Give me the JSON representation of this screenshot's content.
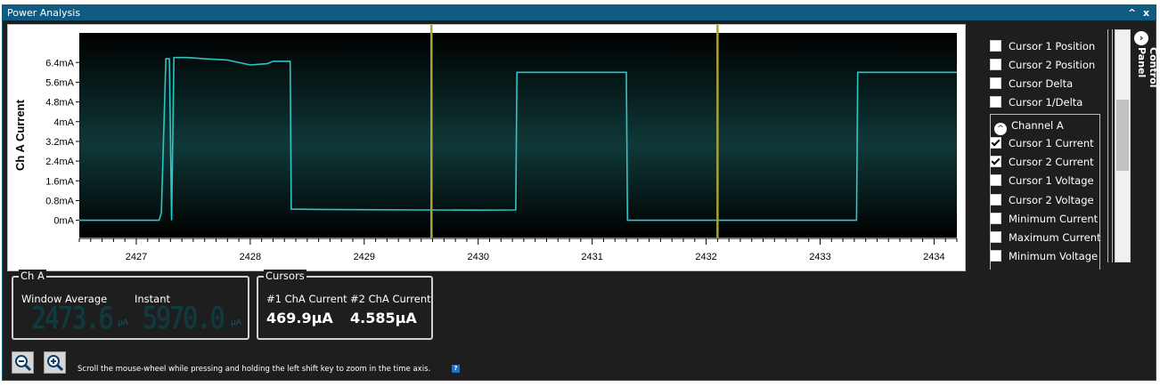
{
  "window": {
    "title": "Power Analysis",
    "controls": [
      "^",
      "x"
    ]
  },
  "chart_data": {
    "type": "line",
    "ylabel": "Ch A Current",
    "y_ticks": [
      "0mA",
      "0.8mA",
      "1.6mA",
      "2.4mA",
      "3.2mA",
      "4mA",
      "4.8mA",
      "5.6mA",
      "6.4mA"
    ],
    "x_ticks": [
      "2427",
      "2428",
      "2429",
      "2430",
      "2431",
      "2432",
      "2433",
      "2434"
    ],
    "xlim": [
      2426.5,
      2434.2
    ],
    "ylim": [
      -0.7,
      7.6
    ],
    "series": [
      {
        "color": "#2cc5c8",
        "x": [
          2426.5,
          2427.2,
          2427.22,
          2427.26,
          2427.29,
          2427.31,
          2427.33,
          2427.35,
          2427.45,
          2427.6,
          2427.8,
          2428.0,
          2428.15,
          2428.2,
          2428.25,
          2428.35,
          2428.36,
          2428.6,
          2429.0,
          2429.5,
          2430.0,
          2430.33,
          2430.34,
          2431.3,
          2431.31,
          2432.0,
          2433.32,
          2433.33,
          2434.2
        ],
        "y": [
          0,
          0,
          0.3,
          6.55,
          6.55,
          0,
          6.6,
          6.6,
          6.6,
          6.55,
          6.5,
          6.3,
          6.35,
          6.45,
          6.45,
          6.45,
          0.45,
          0.44,
          0.43,
          0.42,
          0.41,
          0.42,
          6.0,
          6.0,
          0,
          0,
          0,
          6.0,
          6.0
        ]
      }
    ],
    "cursors_x": [
      2429.59,
      2432.1
    ],
    "cursor_color": "#a9a13a",
    "grid": false
  },
  "control_panel": {
    "label": "Control Panel",
    "items_top": [
      {
        "label": "Cursor 1 Position",
        "checked": false
      },
      {
        "label": "Cursor 2 Position",
        "checked": false
      },
      {
        "label": "Cursor Delta",
        "checked": false
      },
      {
        "label": "Cursor 1/Delta",
        "checked": false
      }
    ],
    "channel_group": "Channel A",
    "channel_items": [
      {
        "label": "Cursor 1 Current",
        "checked": true
      },
      {
        "label": "Cursor 2 Current",
        "checked": true
      },
      {
        "label": "Cursor 1 Voltage",
        "checked": false
      },
      {
        "label": "Cursor 2 Voltage",
        "checked": false
      },
      {
        "label": "Minimum Current",
        "checked": false
      },
      {
        "label": "Maximum Current",
        "checked": false
      },
      {
        "label": "Minimum Voltage",
        "checked": false
      }
    ]
  },
  "cha_group": {
    "legend": "Ch A",
    "window_average_label": "Window Average",
    "instant_label": "Instant",
    "window_average_value": "2473.6",
    "instant_value": "5970.0",
    "unit": "μA"
  },
  "cursors_group": {
    "legend": "Cursors",
    "c1_label": "#1 ChA Current",
    "c2_label": "#2 ChA Current",
    "c1_value": "469.9μA",
    "c2_value": "4.585μA"
  },
  "footer": {
    "hint": "Scroll the mouse-wheel while pressing and holding the left shift key to zoom in the time axis.",
    "help": "?"
  }
}
